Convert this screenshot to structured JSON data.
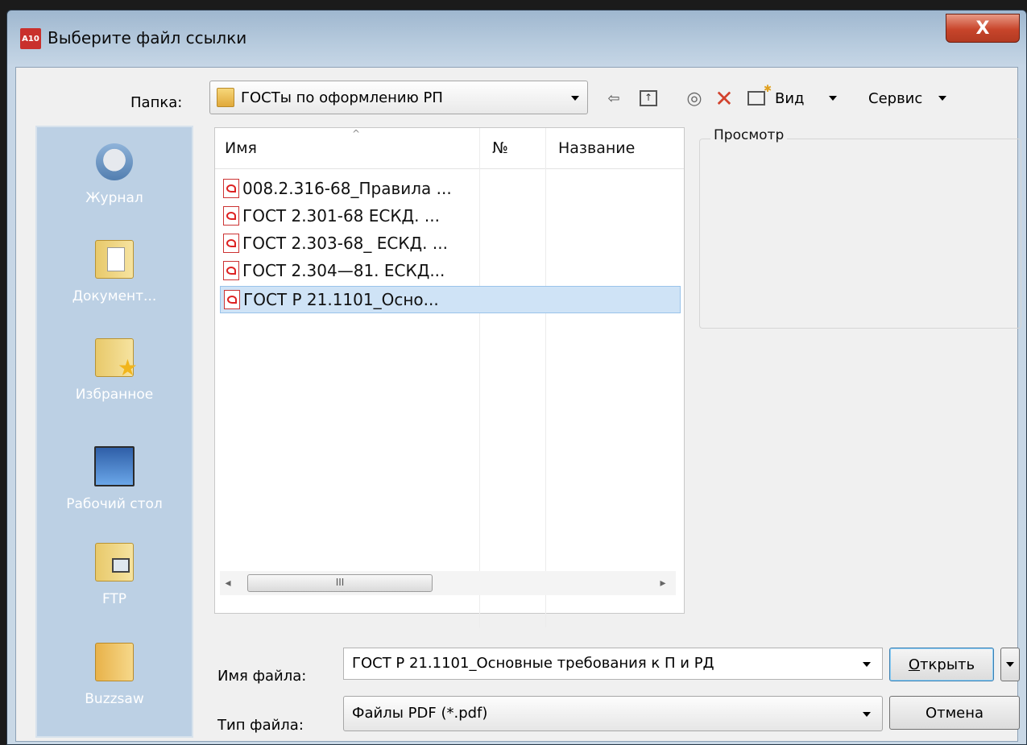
{
  "window": {
    "title": "Выберите файл ссылки",
    "app_icon_text": "A10",
    "close_symbol": "X"
  },
  "toolbar": {
    "folder_label": "Папка:",
    "folder_value": "ГОСТы по оформлению РП",
    "view_label": "Вид",
    "service_label": "Сервис",
    "icons": [
      "back-icon",
      "up-folder-icon",
      "search-web-icon",
      "delete-icon",
      "new-folder-icon"
    ]
  },
  "places": [
    {
      "label": "Журнал",
      "icon": "history-icon"
    },
    {
      "label": "Документ...",
      "icon": "documents-folder-icon"
    },
    {
      "label": "Избранное",
      "icon": "favorites-folder-icon"
    },
    {
      "label": "Рабочий стол",
      "icon": "desktop-icon"
    },
    {
      "label": "FTP",
      "icon": "ftp-folder-icon"
    },
    {
      "label": "Buzzsaw",
      "icon": "buzzsaw-folder-icon"
    }
  ],
  "file_list": {
    "columns": [
      "Имя",
      "№",
      "Название"
    ],
    "sort_indicator": "^",
    "files": [
      {
        "name": "008.2.316-68_Правила ...",
        "icon": "pdf-icon",
        "selected": false
      },
      {
        "name": "ГОСТ 2.301-68 ЕСКД. ...",
        "icon": "pdf-icon",
        "selected": false
      },
      {
        "name": "ГОСТ 2.303-68_ ЕСКД. ...",
        "icon": "pdf-icon",
        "selected": false
      },
      {
        "name": "ГОСТ 2.304—81. ЕСКД...",
        "icon": "pdf-icon",
        "selected": false
      },
      {
        "name": "ГОСТ Р 21.1101_Осно...",
        "icon": "pdf-icon",
        "selected": true
      }
    ],
    "scroll_thumb_grip": "III"
  },
  "preview": {
    "label": "Просмотр"
  },
  "bottom": {
    "filename_label": "Имя файла:",
    "filename_value": "ГОСТ Р 21.1101_Основные требования к П и РД",
    "filetype_label": "Тип файла:",
    "filetype_value": "Файлы PDF (*.pdf)",
    "open_button": "Открыть",
    "cancel_button": "Отмена"
  },
  "colors": {
    "selection": "#cfe3f6",
    "places_bg": "#bcd0e4",
    "close_button": "#c8452b"
  }
}
